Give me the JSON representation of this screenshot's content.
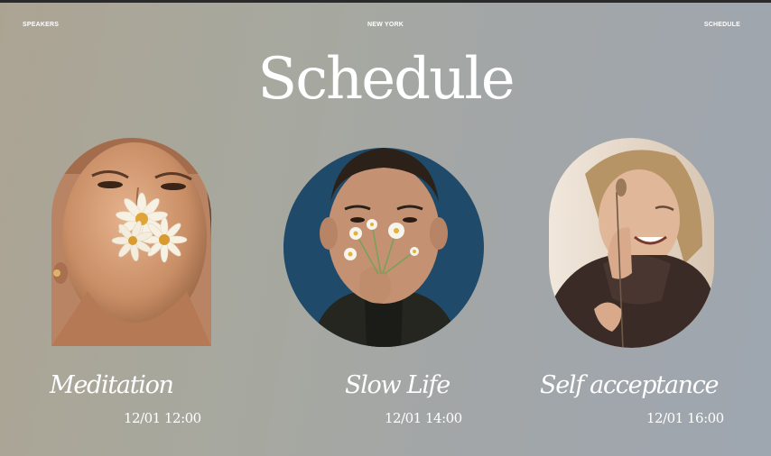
{
  "nav": {
    "left": "SPEAKERS",
    "center": "NEW YORK",
    "right": "SCHEDULE"
  },
  "page_title": "Schedule",
  "sessions": [
    {
      "title": "Meditation",
      "time": "12/01 12:00",
      "image": "woman-with-daisies-in-mouth"
    },
    {
      "title": "Slow Life",
      "time": "12/01 14:00",
      "image": "man-holding-daisies"
    },
    {
      "title": "Self acceptance",
      "time": "12/01 16:00",
      "image": "laughing-woman-with-flower"
    }
  ],
  "colors": {
    "background_left": "#aca493",
    "background_right": "#9ea6b0",
    "text": "#ffffff",
    "photo2_background": "#1f4a6a"
  }
}
